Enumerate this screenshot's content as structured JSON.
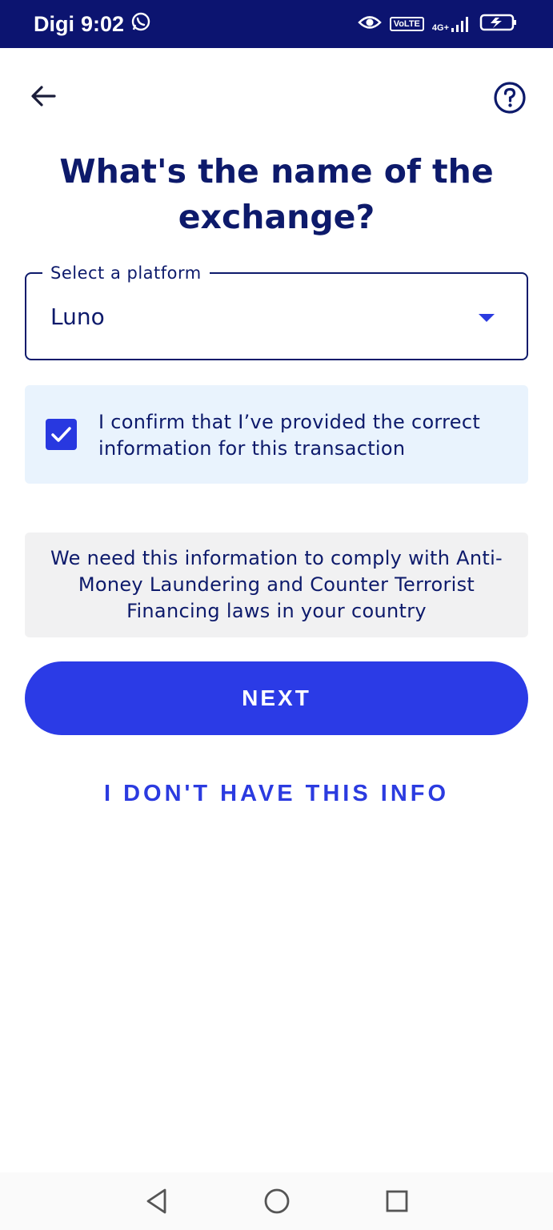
{
  "status_bar": {
    "carrier": "Digi",
    "time": "9:02",
    "volte": "VoLTE",
    "network": "4G+"
  },
  "header": {
    "back_icon": "arrow-left-icon",
    "help_icon": "help-circle-icon"
  },
  "title": "What's the name of the exchange?",
  "platform_select": {
    "label": "Select a platform",
    "value": "Luno"
  },
  "confirm": {
    "checked": true,
    "text": "I confirm that I’ve provided the correct information for this transaction"
  },
  "info_notice": "We need this information to comply with Anti-Money Laundering and Counter Terrorist Financing laws in your country",
  "buttons": {
    "next": "NEXT",
    "no_info": "I DON'T HAVE THIS INFO"
  },
  "colors": {
    "primary": "#2b3be6",
    "heading": "#0d1a6b",
    "status_bar": "#0c1470",
    "confirm_bg": "#e9f3fd",
    "info_bg": "#f1f1f2"
  }
}
